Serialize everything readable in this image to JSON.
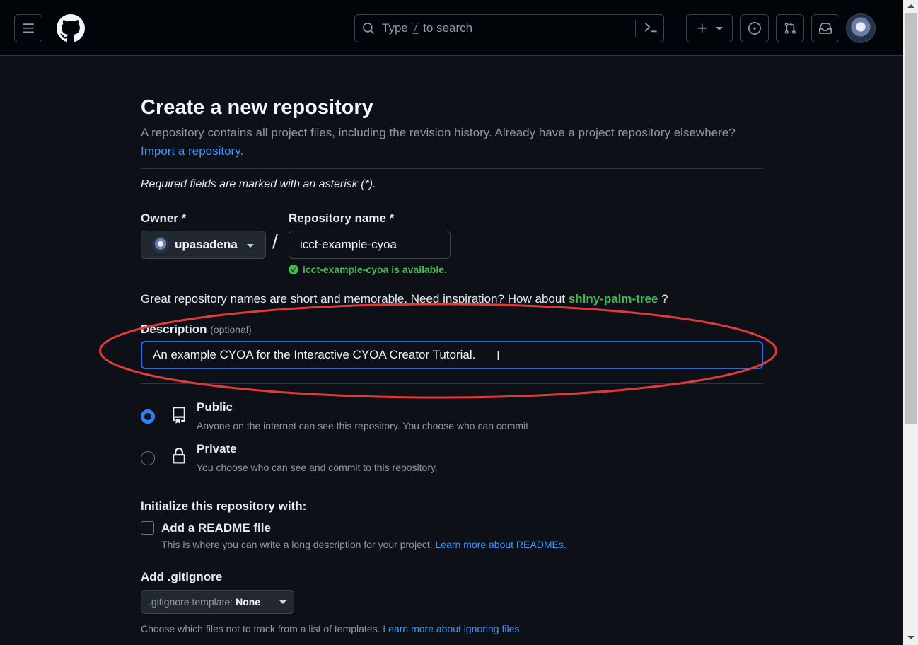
{
  "header": {
    "search_prefix": "Type",
    "search_key": "/",
    "search_suffix": "to search"
  },
  "page": {
    "title": "Create a new repository",
    "lead": "A repository contains all project files, including the revision history. Already have a project repository elsewhere?",
    "import_link": "Import a repository.",
    "required_note": "Required fields are marked with an asterisk (*)."
  },
  "owner": {
    "label": "Owner *",
    "value": "upasadena"
  },
  "separator": "/",
  "repo": {
    "label": "Repository name *",
    "value": "icct-example-cyoa",
    "availability": "icct-example-cyoa is available."
  },
  "suggestion": {
    "text": "Great repository names are short and memorable. Need inspiration? How about",
    "name": "shiny-palm-tree",
    "suffix": "?"
  },
  "description": {
    "label": "Description",
    "optional": "(optional)",
    "value": "An example CYOA for the Interactive CYOA Creator Tutorial."
  },
  "visibility": {
    "selected": "Public",
    "public": {
      "title": "Public",
      "desc": "Anyone on the internet can see this repository. You choose who can commit."
    },
    "private": {
      "title": "Private",
      "desc": "You choose who can see and commit to this repository."
    }
  },
  "initialize": {
    "title": "Initialize this repository with:",
    "readme_label": "Add a README file",
    "readme_checked": false,
    "readme_desc": "This is where you can write a long description for your project.",
    "readme_link": "Learn more about READMEs."
  },
  "gitignore": {
    "title": "Add .gitignore",
    "template_prefix": ".gitignore template:",
    "template_value": "None",
    "desc": "Choose which files not to track from a list of templates.",
    "link": "Learn more about ignoring files."
  },
  "colors": {
    "background": "#0d1117",
    "header": "#010409",
    "accent_blue": "#4493f8",
    "success_green": "#3fb950",
    "annotation_red": "#e03a3a"
  },
  "icons": [
    "hamburger-menu-icon",
    "github-logo-icon",
    "search-icon",
    "command-palette-icon",
    "plus-icon",
    "issue-opened-icon",
    "git-pull-request-icon",
    "inbox-icon",
    "check-circle-icon",
    "repo-icon",
    "lock-icon"
  ]
}
